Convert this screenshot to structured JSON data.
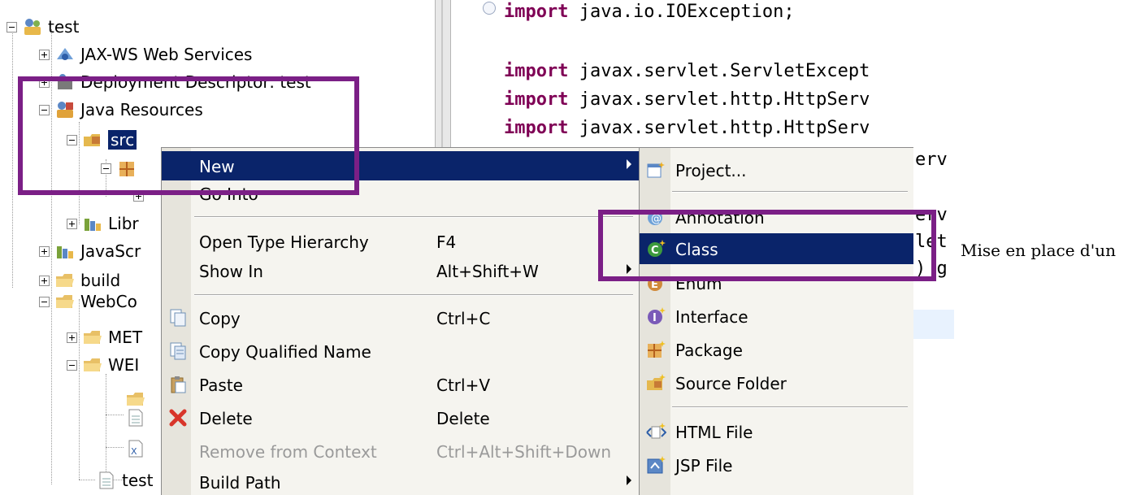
{
  "tree": {
    "project": "test",
    "items": {
      "jaxws": "JAX-WS Web Services",
      "deployment": "Deployment Descriptor: test",
      "java_resources": "Java Resources",
      "src": "src",
      "libraries": "Libr",
      "javascript": "JavaScr",
      "build": "build",
      "webcontent": "WebCo",
      "metainf": "MET",
      "webinf": "WEI",
      "test_file": "test"
    }
  },
  "editor": {
    "lines": [
      {
        "kw": "import",
        "rest": " java.io.IOException;"
      },
      {
        "kw": "import",
        "rest": " javax.servlet.ServletExcept"
      },
      {
        "kw": "import",
        "rest": " javax.servlet.http.HttpServ"
      },
      {
        "kw": "import",
        "rest": " javax.servlet.http.HttpServ"
      }
    ],
    "partials": [
      "erv",
      "erv",
      "let",
      ") g"
    ]
  },
  "context_menu": {
    "new": "New",
    "go_into": "Go Into",
    "open_type_hierarchy": "Open Type Hierarchy",
    "open_type_hierarchy_shortcut": "F4",
    "show_in": "Show In",
    "show_in_shortcut": "Alt+Shift+W",
    "copy": "Copy",
    "copy_shortcut": "Ctrl+C",
    "copy_qualified_name": "Copy Qualified Name",
    "paste": "Paste",
    "paste_shortcut": "Ctrl+V",
    "delete": "Delete",
    "delete_shortcut": "Delete",
    "remove_from_context": "Remove from Context",
    "remove_from_context_shortcut": "Ctrl+Alt+Shift+Down",
    "build_path": "Build Path"
  },
  "submenu": {
    "project": "Project...",
    "annotation": "Annotation",
    "class": "Class",
    "enum": "Enum",
    "interface": "Interface",
    "package": "Package",
    "source_folder": "Source Folder",
    "html_file": "HTML File",
    "jsp_file": "JSP File"
  },
  "caption": "Mise en place d'un",
  "colors": {
    "highlight": "#0a246a",
    "annotation": "#7b1f86",
    "keyword": "#7f0055"
  }
}
